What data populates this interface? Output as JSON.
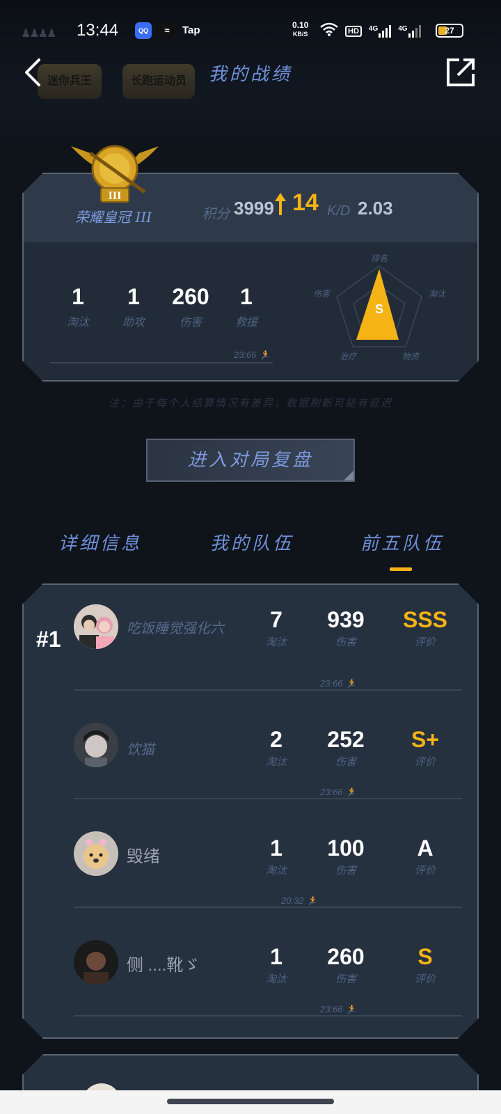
{
  "status_bar": {
    "people_icon": "people-icon",
    "time": "13:44",
    "app1": "QQ",
    "app2": "≈",
    "app3": "Tap",
    "net_speed_value": "0.10",
    "net_speed_unit": "KB/S",
    "hd_label": "HD",
    "signal1": "4G",
    "signal2": "4G",
    "battery": "27"
  },
  "header": {
    "title": "我的战绩",
    "tag1": "迷你兵王",
    "tag2": "长跑运动员"
  },
  "summary": {
    "rank_name": "荣耀皇冠 III",
    "rank_level": "III",
    "points_label": "积分",
    "points": "3999",
    "points_change": "14",
    "kd_label": "K/D",
    "kd": "2.03",
    "stats": [
      {
        "value": "1",
        "label": "淘汰"
      },
      {
        "value": "1",
        "label": "助攻"
      },
      {
        "value": "260",
        "label": "伤害"
      },
      {
        "value": "1",
        "label": "救援"
      }
    ],
    "radar": {
      "grade": "S",
      "labels": [
        "排名",
        "淘汰",
        "物资",
        "治疗",
        "伤害"
      ]
    },
    "survival_time": "23:66"
  },
  "note": "注：由于每个人结算情况有差异，数据刷新可能有延迟",
  "replay_button": "进入对局复盘",
  "tabs": [
    {
      "label": "详细信息"
    },
    {
      "label": "我的队伍"
    },
    {
      "label": "前五队伍"
    }
  ],
  "team": {
    "rank": "#1",
    "players": [
      {
        "name": "吃饭睡觉强化六",
        "kills": "7",
        "kills_label": "淘汰",
        "damage": "939",
        "damage_label": "伤害",
        "rating": "SSS",
        "rating_label": "评价",
        "time": "23:66"
      },
      {
        "name": "饮猫",
        "kills": "2",
        "kills_label": "淘汰",
        "damage": "252",
        "damage_label": "伤害",
        "rating": "S+",
        "rating_label": "评价",
        "time": "23:66"
      },
      {
        "name": "毁绪",
        "kills": "1",
        "kills_label": "淘汰",
        "damage": "100",
        "damage_label": "伤害",
        "rating": "A",
        "rating_label": "评价",
        "time": "20:32"
      },
      {
        "name": "侧 ....靴ゞ",
        "kills": "1",
        "kills_label": "淘汰",
        "damage": "260",
        "damage_label": "伤害",
        "rating": "S",
        "rating_label": "评价",
        "time": "23:66"
      }
    ]
  },
  "colors": {
    "accent": "#f5b316",
    "label_blue": "#6f8fd8",
    "card_bg": "#263140"
  }
}
